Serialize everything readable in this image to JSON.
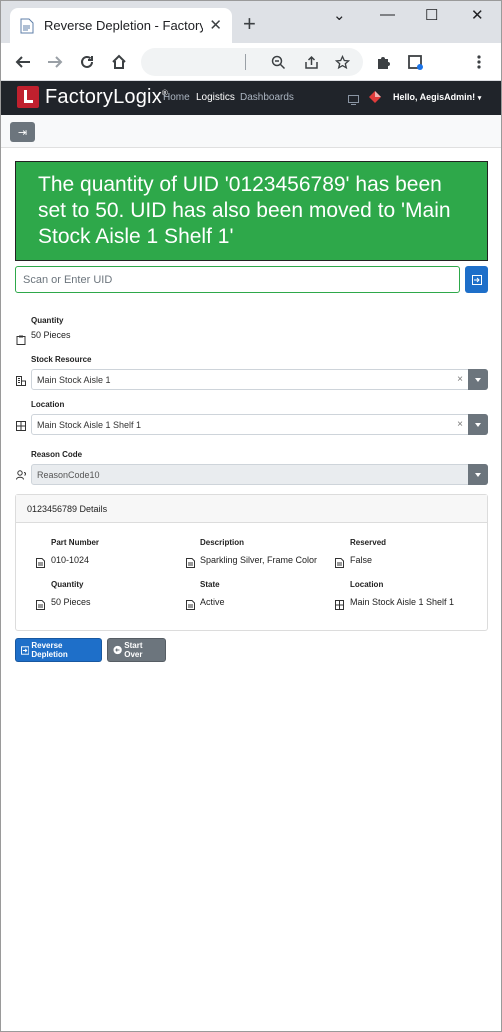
{
  "browser": {
    "tab_title": "Reverse Depletion - FactoryLogix",
    "tab_close": "✕",
    "new_tab": "+",
    "window_controls": {
      "minimize": "—",
      "maximize": "☐",
      "close": "✕",
      "tabsearch": "⌄"
    },
    "icons": [
      "back-arrow-icon",
      "forward-arrow-icon",
      "reload-icon",
      "home-icon",
      "zoom-out-icon",
      "share-icon",
      "star-icon",
      "extensions-icon",
      "sidepanel-icon",
      "menu-icon"
    ]
  },
  "app": {
    "logo": "FactoryLogix",
    "logo_mark": "®",
    "nav": [
      "Home",
      "Logistics",
      "Dashboards"
    ],
    "active_nav": "Logistics",
    "user_greeting": "Hello, AegisAdmin!",
    "collapse_glyph": "⇥"
  },
  "alert": {
    "message": "The quantity of UID '0123456789' has been set to 50. UID has also been moved to 'Main Stock Aisle 1 Shelf 1'",
    "color": "#2ea84a"
  },
  "uid": {
    "placeholder": "Scan or Enter UID",
    "value": ""
  },
  "fields": {
    "quantity": {
      "label": "Quantity",
      "value": "50 Pieces"
    },
    "stock_resource": {
      "label": "Stock Resource",
      "value": "Main Stock Aisle 1",
      "clear": "×"
    },
    "location": {
      "label": "Location",
      "value": "Main Stock Aisle 1 Shelf 1",
      "clear": "×"
    },
    "reason_code": {
      "label": "Reason Code",
      "value": "ReasonCode10"
    }
  },
  "details": {
    "header": "0123456789 Details",
    "part_number": {
      "label": "Part Number",
      "value": "010-1024"
    },
    "description": {
      "label": "Description",
      "value": "Sparkling Silver, Frame Color"
    },
    "reserved": {
      "label": "Reserved",
      "value": "False"
    },
    "quantity": {
      "label": "Quantity",
      "value": "50 Pieces"
    },
    "state": {
      "label": "State",
      "value": "Active"
    },
    "location": {
      "label": "Location",
      "value": "Main Stock Aisle 1 Shelf 1"
    }
  },
  "buttons": {
    "reverse_depletion": "Reverse Depletion",
    "start_over": "Start Over"
  },
  "colors": {
    "primary": "#1e6fc9",
    "secondary": "#6c757d",
    "appbar": "#20242a",
    "success": "#2ea84a"
  }
}
